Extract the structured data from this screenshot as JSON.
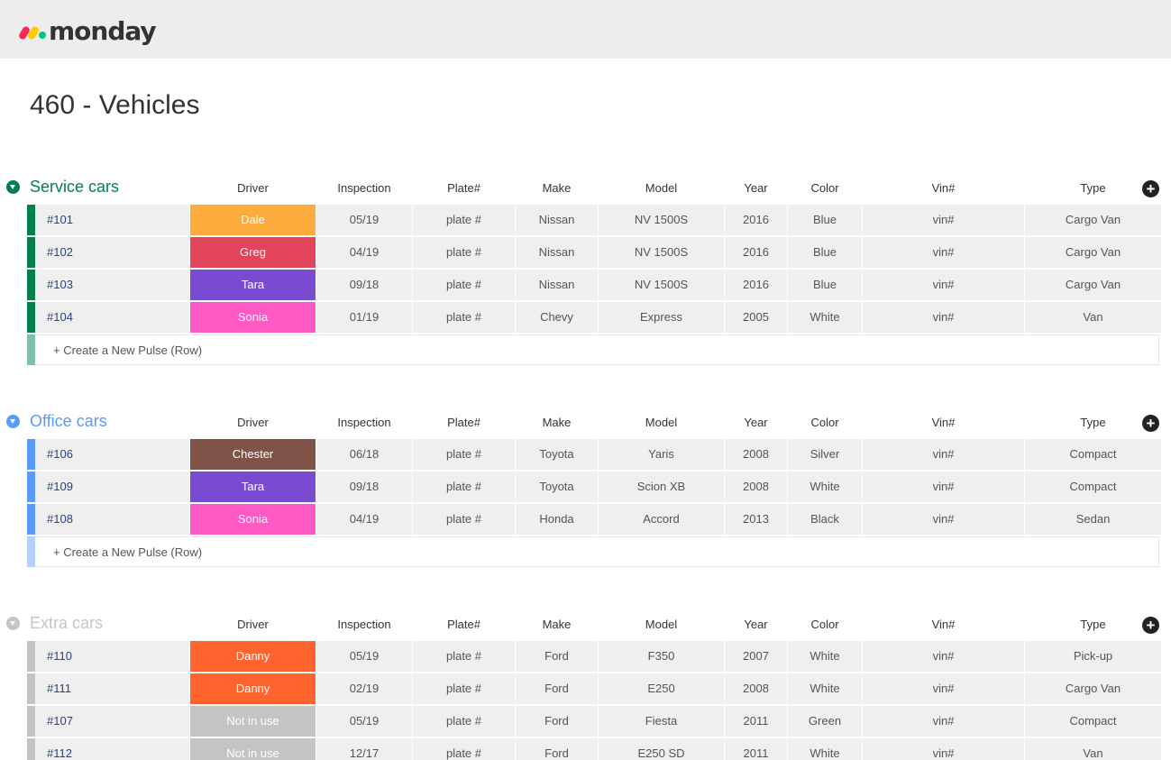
{
  "app": {
    "logo_text": "monday"
  },
  "board": {
    "title": "460 - Vehicles"
  },
  "columns": [
    "Driver",
    "Inspection",
    "Plate#",
    "Make",
    "Model",
    "Year",
    "Color",
    "Vin#",
    "Type"
  ],
  "new_row_label": "+ Create a New Pulse (Row)",
  "groups": [
    {
      "name": "Service cars",
      "color": "#037f4c",
      "stripe_light": "#80bfa5",
      "rows": [
        {
          "id": "#101",
          "driver": "Dale",
          "driver_color": "#fdab3d",
          "inspection": "05/19",
          "plate": "plate #",
          "make": "Nissan",
          "model": "NV 1500S",
          "year": "2016",
          "color": "Blue",
          "vin": "vin#",
          "type": "Cargo Van"
        },
        {
          "id": "#102",
          "driver": "Greg",
          "driver_color": "#e2445c",
          "inspection": "04/19",
          "plate": "plate #",
          "make": "Nissan",
          "model": "NV 1500S",
          "year": "2016",
          "color": "Blue",
          "vin": "vin#",
          "type": "Cargo Van"
        },
        {
          "id": "#103",
          "driver": "Tara",
          "driver_color": "#784bd1",
          "inspection": "09/18",
          "plate": "plate #",
          "make": "Nissan",
          "model": "NV 1500S",
          "year": "2016",
          "color": "Blue",
          "vin": "vin#",
          "type": "Cargo Van"
        },
        {
          "id": "#104",
          "driver": "Sonia",
          "driver_color": "#ff5ac4",
          "inspection": "01/19",
          "plate": "plate #",
          "make": "Chevy",
          "model": "Express",
          "year": "2005",
          "color": "White",
          "vin": "vin#",
          "type": "Van"
        }
      ],
      "show_new_row": true
    },
    {
      "name": "Office cars",
      "color": "#579bfc",
      "stripe_light": "#b3d1fd",
      "rows": [
        {
          "id": "#106",
          "driver": "Chester",
          "driver_color": "#7f5347",
          "inspection": "06/18",
          "plate": "plate #",
          "make": "Toyota",
          "model": "Yaris",
          "year": "2008",
          "color": "Silver",
          "vin": "vin#",
          "type": "Compact"
        },
        {
          "id": "#109",
          "driver": "Tara",
          "driver_color": "#784bd1",
          "inspection": "09/18",
          "plate": "plate #",
          "make": "Toyota",
          "model": "Scion XB",
          "year": "2008",
          "color": "White",
          "vin": "vin#",
          "type": "Compact"
        },
        {
          "id": "#108",
          "driver": "Sonia",
          "driver_color": "#ff5ac4",
          "inspection": "04/19",
          "plate": "plate #",
          "make": "Honda",
          "model": "Accord",
          "year": "2013",
          "color": "Black",
          "vin": "vin#",
          "type": "Sedan"
        }
      ],
      "show_new_row": true
    },
    {
      "name": "Extra cars",
      "color": "#c4c4c4",
      "stripe_light": "#e0e0e0",
      "rows": [
        {
          "id": "#110",
          "driver": "Danny",
          "driver_color": "#ff642e",
          "inspection": "05/19",
          "plate": "plate #",
          "make": "Ford",
          "model": "F350",
          "year": "2007",
          "color": "White",
          "vin": "vin#",
          "type": "Pick-up"
        },
        {
          "id": "#111",
          "driver": "Danny",
          "driver_color": "#ff642e",
          "inspection": "02/19",
          "plate": "plate #",
          "make": "Ford",
          "model": "E250",
          "year": "2008",
          "color": "White",
          "vin": "vin#",
          "type": "Cargo Van"
        },
        {
          "id": "#107",
          "driver": "Not in use",
          "driver_color": "#c4c4c4",
          "inspection": "05/19",
          "plate": "plate #",
          "make": "Ford",
          "model": "Fiesta",
          "year": "2011",
          "color": "Green",
          "vin": "vin#",
          "type": "Compact"
        },
        {
          "id": "#112",
          "driver": "Not in use",
          "driver_color": "#c4c4c4",
          "inspection": "12/17",
          "plate": "plate #",
          "make": "Ford",
          "model": "E250 SD",
          "year": "2011",
          "color": "White",
          "vin": "vin#",
          "type": "Van"
        }
      ],
      "show_new_row": false
    }
  ]
}
